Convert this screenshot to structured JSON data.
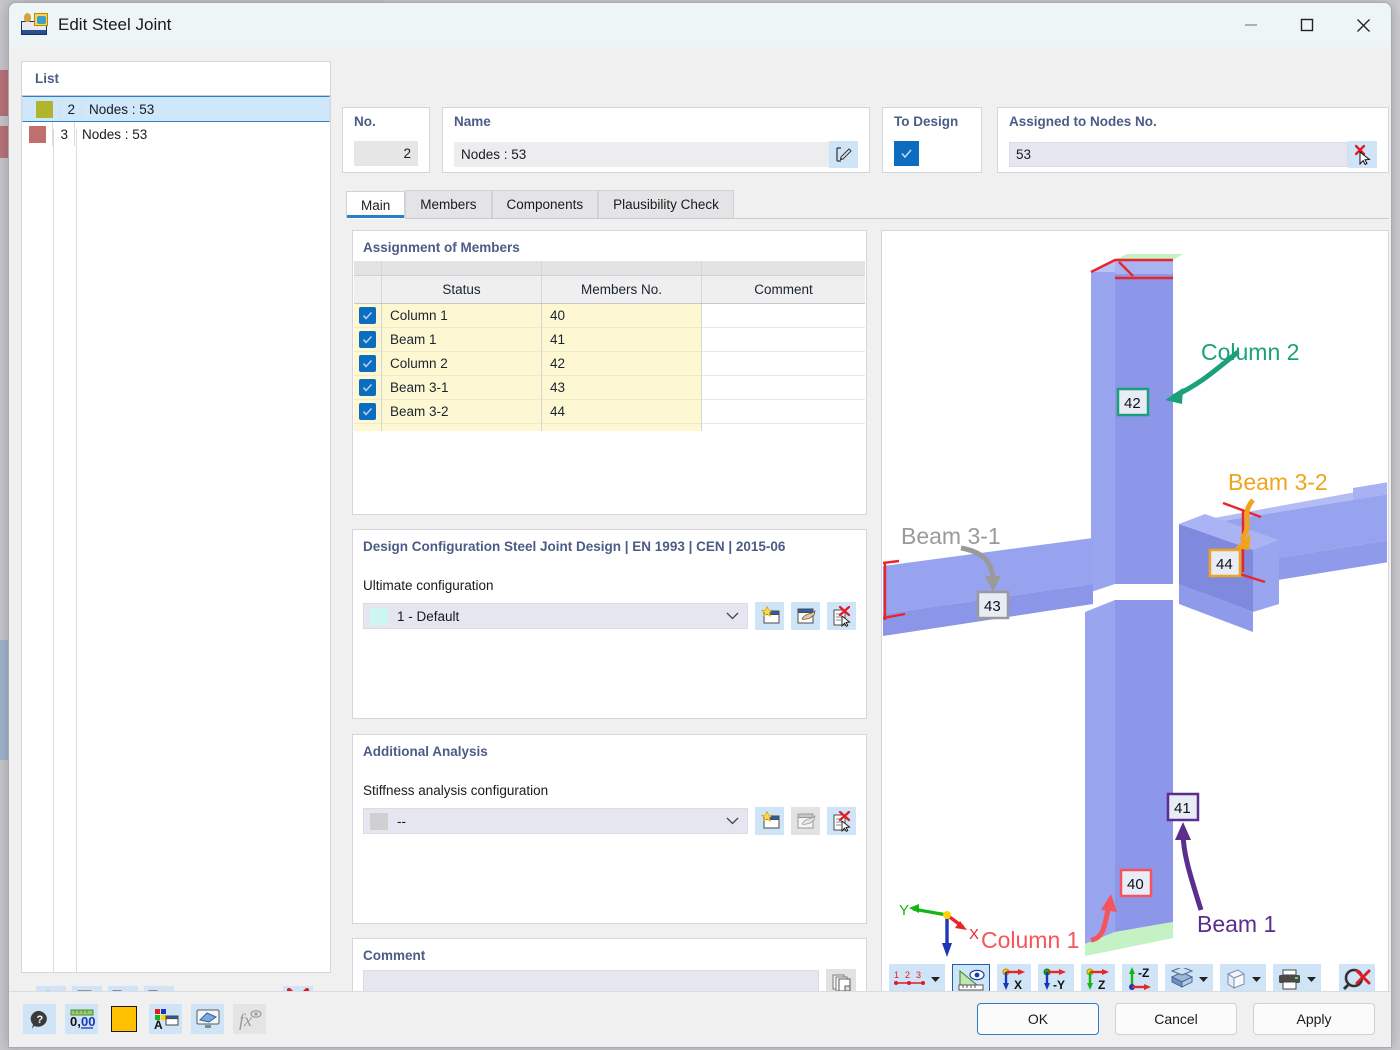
{
  "window": {
    "title": "Edit Steel Joint",
    "app_icon": "steel-joint-icon",
    "minimize": "minimize-icon",
    "maximize": "maximize-icon",
    "close": "close-icon"
  },
  "list_panel": {
    "title": "List",
    "rows": [
      {
        "color": "#b0b42e",
        "no": "2",
        "name": "Nodes : 53",
        "selected": true
      },
      {
        "color": "#c06e6e",
        "no": "3",
        "name": "Nodes : 53",
        "selected": false
      }
    ],
    "toolbar": [
      {
        "name": "new-joint-button",
        "icon": "new-window-icon"
      },
      {
        "name": "copy-joint-button",
        "icon": "copy-window-icon"
      },
      {
        "name": "select-all-button",
        "icon": "checklist-check-icon"
      },
      {
        "name": "invert-selection-button",
        "icon": "checklist-refresh-icon"
      },
      {
        "name": "delete-joint-button",
        "icon": "red-x-icon"
      }
    ]
  },
  "fields": {
    "no_label": "No.",
    "no_value": "2",
    "name_label": "Name",
    "name_value": "Nodes : 53",
    "name_edit_icon": "pencil-edit-icon",
    "to_design_label": "To Design",
    "to_design_checked": true,
    "assigned_label": "Assigned to Nodes No.",
    "assigned_value": "53",
    "assigned_pick_icon": "pick-deselect-icon"
  },
  "tabs": [
    {
      "label": "Main",
      "active": true
    },
    {
      "label": "Members",
      "active": false
    },
    {
      "label": "Components",
      "active": false
    },
    {
      "label": "Plausibility Check",
      "active": false
    }
  ],
  "assignment": {
    "title": "Assignment of Members",
    "columns": [
      "",
      "Status",
      "Members No.",
      "Comment"
    ],
    "rows": [
      {
        "checked": true,
        "status": "Column 1",
        "member_no": "40",
        "comment": ""
      },
      {
        "checked": true,
        "status": "Beam 1",
        "member_no": "41",
        "comment": ""
      },
      {
        "checked": true,
        "status": "Column 2",
        "member_no": "42",
        "comment": ""
      },
      {
        "checked": true,
        "status": "Beam 3-1",
        "member_no": "43",
        "comment": ""
      },
      {
        "checked": true,
        "status": "Beam 3-2",
        "member_no": "44",
        "comment": ""
      }
    ]
  },
  "design_config": {
    "title": "Design Configuration Steel Joint Design | EN 1993 | CEN | 2015-06",
    "field_label": "Ultimate configuration",
    "value": "1 - Default",
    "swatch_color": "#cdf5f2",
    "buttons": [
      {
        "name": "new-configuration-button",
        "icon": "new-window-star-icon",
        "enabled": true
      },
      {
        "name": "edit-configuration-button",
        "icon": "edit-hand-icon",
        "enabled": true
      },
      {
        "name": "delete-configuration-button",
        "icon": "delete-document-icon",
        "enabled": true
      }
    ]
  },
  "additional_analysis": {
    "title": "Additional Analysis",
    "field_label": "Stiffness analysis configuration",
    "value": "--",
    "swatch_color": "#d0d0d0",
    "buttons": [
      {
        "name": "new-stiffness-config-button",
        "icon": "new-window-star-icon",
        "enabled": true
      },
      {
        "name": "edit-stiffness-config-button",
        "icon": "edit-hand-icon",
        "enabled": false
      },
      {
        "name": "delete-stiffness-config-button",
        "icon": "delete-document-icon",
        "enabled": true
      }
    ]
  },
  "comment": {
    "title": "Comment",
    "value": "",
    "copy_icon": "copy-pages-icon"
  },
  "viewport": {
    "labels": [
      {
        "text": "Column 2",
        "color": "#1aa17a",
        "tag": "42"
      },
      {
        "text": "Beam 3-2",
        "color": "#f0a41e",
        "tag": "44"
      },
      {
        "text": "Beam 3-1",
        "color": "#9a9a9a",
        "tag": "43"
      },
      {
        "text": "Beam 1",
        "color": "#5b2d8e",
        "tag": "41"
      },
      {
        "text": "Column 1",
        "color": "#f4545b",
        "tag": "40"
      }
    ],
    "axes": {
      "x": "X",
      "y": "Y",
      "z": "Z"
    },
    "member_color": "#8f9bee",
    "toolbar": [
      {
        "name": "numbering-button",
        "icon": "numbering-123-icon",
        "has_dropdown": true
      },
      {
        "name": "dimensions-button",
        "icon": "ruler-eye-icon",
        "active": true
      },
      {
        "name": "view-x-button",
        "icon": "view-axis-x-icon",
        "label": "X"
      },
      {
        "name": "view-negy-button",
        "icon": "view-axis-negy-icon",
        "label": "-Y"
      },
      {
        "name": "view-z-button",
        "icon": "view-axis-z-icon",
        "label": "Z"
      },
      {
        "name": "view-negz-button",
        "icon": "view-axis-negz-icon",
        "label": "-Z"
      },
      {
        "name": "render-mode-button",
        "icon": "solid-box-icon",
        "has_dropdown": true
      },
      {
        "name": "wireframe-button",
        "icon": "wireframe-cube-icon",
        "has_dropdown": true
      },
      {
        "name": "print-button",
        "icon": "printer-icon",
        "has_dropdown": true
      },
      {
        "name": "zoom-reset-button",
        "icon": "magnifier-red-x-icon"
      }
    ]
  },
  "bottom_bar": {
    "left_buttons": [
      {
        "name": "help-button",
        "icon": "question-balloon-icon"
      },
      {
        "name": "units-button",
        "icon": "units-000-icon"
      },
      {
        "name": "color-button",
        "icon": "color-swatch-icon",
        "color": "#ffc000"
      },
      {
        "name": "display-properties-button",
        "icon": "colors-text-window-icon"
      },
      {
        "name": "visibility-button",
        "icon": "monitor-shape-icon"
      },
      {
        "name": "formula-button",
        "icon": "fx-eye-icon",
        "enabled": false
      }
    ],
    "ok": "OK",
    "cancel": "Cancel",
    "apply": "Apply"
  }
}
